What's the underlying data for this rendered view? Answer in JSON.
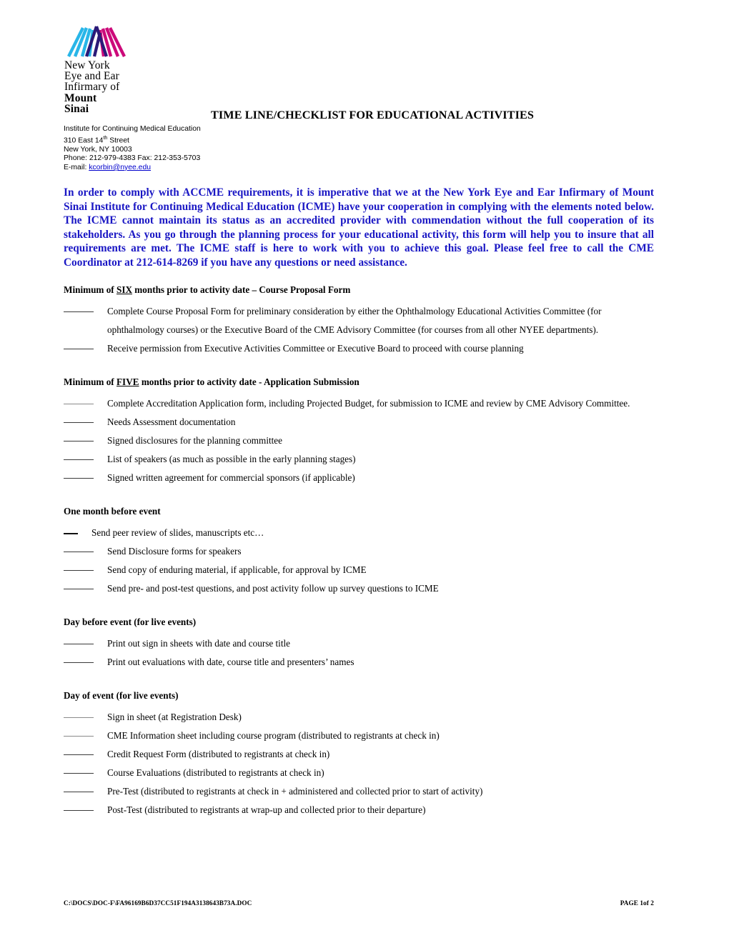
{
  "header": {
    "logo": {
      "name": "new-york-eye-and-ear-infirmary-of-mount-sinai-logo",
      "line1": "New York",
      "line2": "Eye and Ear",
      "line3": "Infirmary of",
      "line4": "Mount",
      "line5": "Sinai",
      "colors": {
        "cyan": "#29b6e8",
        "navy": "#2b1a78",
        "magenta": "#cc0a7a"
      }
    },
    "title": "TIME LINE/CHECKLIST FOR EDUCATIONAL ACTIVITIES",
    "address": {
      "institute": "Institute for Continuing Medical Education",
      "street_prefix": "310 East 14",
      "street_superscript": "th",
      "street_suffix": " Street",
      "city_state_zip": "New York, NY  10003",
      "phone_fax": "Phone: 212-979-4383 Fax: 212-353-5703",
      "email_label": "E-mail: ",
      "email": "kcorbin@nyee.edu",
      "email_color": "#0000cc"
    }
  },
  "intro": {
    "color": "#1a17c4",
    "text": "In order to comply with ACCME requirements, it is imperative that we at the New York Eye and Ear Infirmary of Mount Sinai Institute for Continuing Medical Education (ICME) have your cooperation in complying with the elements noted below.  The ICME cannot maintain its status as an accredited provider with commendation without the full cooperation of its stakeholders.  As you go through the planning process for your educational activity, this form will help you to insure that all requirements are met. The ICME staff is here to work with you to achieve this goal.  Please feel free to call the CME Coordinator at 212-614-8269 if you have any questions or need assistance."
  },
  "sections": [
    {
      "heading_pre": "Minimum of ",
      "heading_underlined": "SIX",
      "heading_post": " months prior to activity date – Course Proposal Form",
      "items": [
        {
          "blank": "normal",
          "text": "Complete  Course Proposal Form  for preliminary consideration by either the Ophthalmology Educational Activities Committee (for ophthalmology  courses) or the Executive Board of the CME Advisory Committee (for courses from all other NYEE departments)."
        },
        {
          "blank": "normal",
          "text": "Receive permission from Executive Activities Committee or Executive Board to proceed with course planning"
        }
      ]
    },
    {
      "heading_pre": "Minimum of ",
      "heading_underlined": "FIVE",
      "heading_post": " months prior to activity date - Application Submission",
      "items": [
        {
          "blank": "faint",
          "text": "Complete  Accreditation Application form,  including Projected Budget, for submission to ICME and review by CME Advisory Committee."
        },
        {
          "blank": "normal",
          "text": "Needs Assessment documentation"
        },
        {
          "blank": "normal",
          "text": "Signed disclosures for the planning committee"
        },
        {
          "blank": "normal",
          "text": "List of speakers (as much as possible in the early planning stages)"
        },
        {
          "blank": "normal",
          "text": "Signed written agreement for commercial sponsors (if applicable)"
        }
      ]
    },
    {
      "heading_pre": "",
      "heading_underlined": "",
      "heading_post": "One month before event",
      "items": [
        {
          "blank": "short",
          "text": "Send peer review of slides, manuscripts etc…"
        },
        {
          "blank": "normal",
          "text": "Send Disclosure forms for speakers"
        },
        {
          "blank": "normal",
          "text": "Send copy of enduring material, if applicable, for approval by ICME"
        },
        {
          "blank": "normal",
          "text": "Send pre- and post-test  questions, and post activity follow up survey questions to ICME"
        }
      ]
    },
    {
      "heading_pre": "",
      "heading_underlined": "",
      "heading_post": "Day before event (for live events)",
      "items": [
        {
          "blank": "normal",
          "text": "Print out sign in sheets with date and course title"
        },
        {
          "blank": "normal",
          "text": "Print out evaluations with date, course title and presenters’ names"
        }
      ]
    },
    {
      "heading_pre": "",
      "heading_underlined": "",
      "heading_post": "Day of event (for live events)",
      "items": [
        {
          "blank": "faint",
          "text": "Sign in sheet (at Registration Desk)"
        },
        {
          "blank": "faint",
          "text": "CME Information sheet including course program (distributed to registrants at check in)"
        },
        {
          "blank": "normal",
          "text": "Credit Request Form (distributed to registrants at check in)"
        },
        {
          "blank": "normal",
          "text": "Course Evaluations (distributed to registrants at check in)"
        },
        {
          "blank": "normal",
          "text": "Pre-Test (distributed to registrants at check in + administered and collected prior to start of activity)"
        },
        {
          "blank": "normal",
          "text": "Post-Test (distributed to registrants at wrap-up and collected prior to their departure)"
        }
      ]
    }
  ],
  "footer": {
    "path": "C:\\DOCS\\DOC-F\\FA96169B6D37CC51F194A3138643B73A.DOC",
    "page": "PAGE 1of 2"
  }
}
